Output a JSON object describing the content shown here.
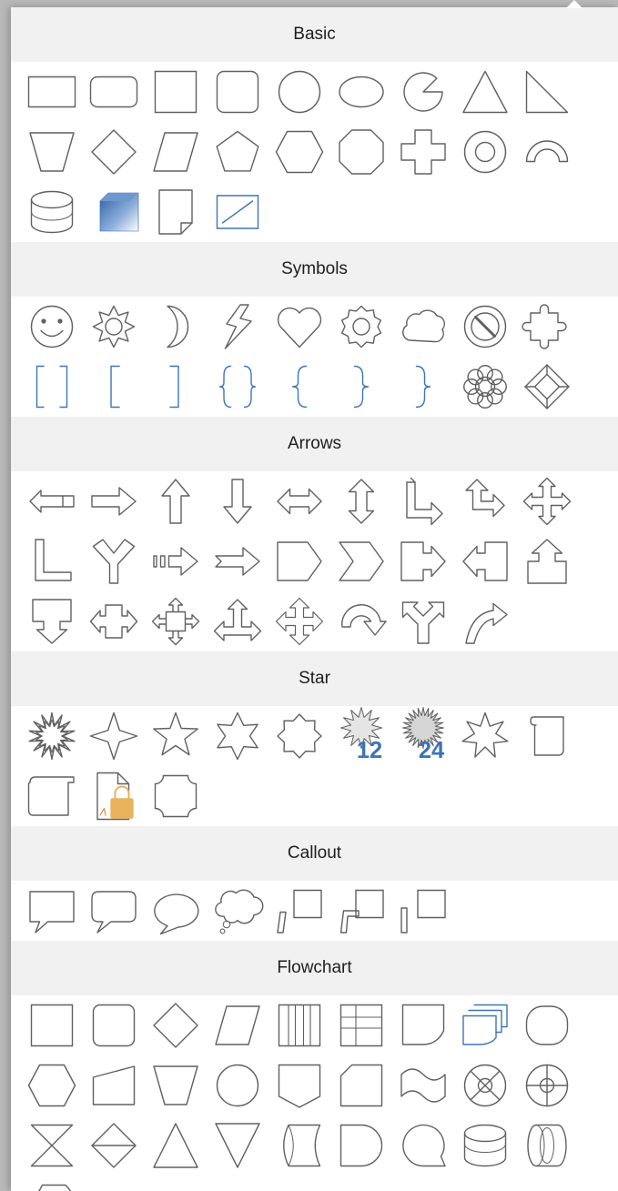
{
  "sections": [
    {
      "title": "Basic",
      "shapes": [
        "rectangle",
        "rounded-rectangle",
        "square",
        "rounded-square",
        "circle",
        "ellipse",
        "pie",
        "triangle",
        "right-triangle",
        "trapezoid",
        "diamond",
        "parallelogram",
        "pentagon",
        "hexagon",
        "octagon",
        "cross",
        "donut",
        "block-arc",
        "can",
        "cube",
        "folded-corner",
        "frame"
      ]
    },
    {
      "title": "Symbols",
      "shapes": [
        "smiley-face",
        "sun",
        "moon",
        "lightning-bolt",
        "heart",
        "gear",
        "cloud",
        "no-symbol",
        "puzzle",
        "double-bracket",
        "left-bracket",
        "right-bracket",
        "double-brace",
        "left-brace",
        "right-brace",
        "right-brace-2",
        "flower",
        "bevel-diamond"
      ]
    },
    {
      "title": "Arrows",
      "shapes": [
        "left-right-arrow-wide",
        "right-arrow",
        "up-arrow",
        "down-arrow",
        "left-right-arrow",
        "up-down-arrow",
        "bent-up-arrow",
        "bent-up-right-arrow",
        "quad-arrow",
        "left-up-arrow",
        "split-arrow",
        "striped-right-arrow",
        "notched-right-arrow",
        "pentagon-arrow",
        "chevron",
        "right-arrow-callout",
        "left-arrow-callout",
        "up-arrow-callout",
        "down-arrow-callout",
        "left-right-arrow-callout",
        "quad-arrow-callout",
        "left-right-up-arrow",
        "four-way-arrow",
        "circular-arrow",
        "up-split-arrow",
        "curved-up-arrow"
      ]
    },
    {
      "title": "Star",
      "shapes": [
        "explosion",
        "star-4",
        "star-5",
        "star-6",
        "star-8",
        "star-12",
        "star-24",
        "star-7",
        "vertical-scroll",
        "horizontal-scroll",
        "signature-lock",
        "plaque"
      ],
      "labels": {
        "star-12": "12",
        "star-24": "24"
      }
    },
    {
      "title": "Callout",
      "shapes": [
        "rect-callout",
        "rounded-rect-callout",
        "oval-callout",
        "cloud-callout",
        "line-callout-1",
        "line-callout-2",
        "line-callout-3"
      ]
    },
    {
      "title": "Flowchart",
      "shapes": [
        "process",
        "alternate-process",
        "decision",
        "data",
        "predefined-process",
        "internal-storage",
        "document",
        "multidocument",
        "terminator",
        "preparation",
        "manual-input",
        "manual-operation",
        "connector",
        "off-page-connector",
        "card",
        "punched-tape",
        "summing-junction",
        "or",
        "collate",
        "sort",
        "extract",
        "merge",
        "stored-data",
        "delay",
        "sequential-storage",
        "magnetic-disk",
        "direct-access-storage",
        "display"
      ]
    }
  ],
  "colors": {
    "stroke": "#606060",
    "accent": "#3d74b6",
    "header_bg": "#f1f1f1",
    "lock": "#e8b35c"
  }
}
